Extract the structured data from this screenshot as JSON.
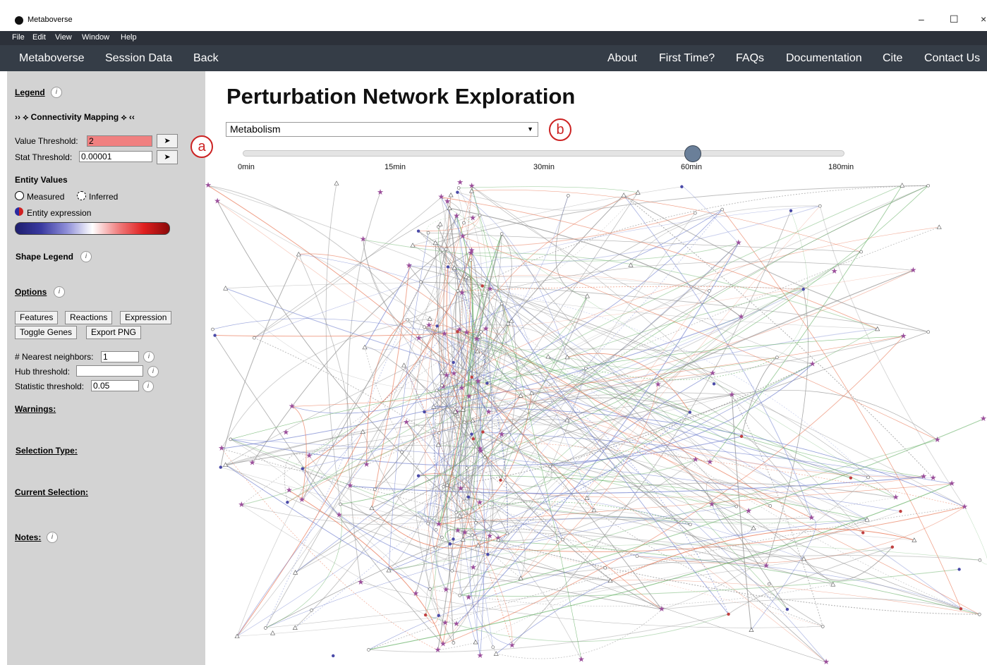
{
  "window": {
    "title": "Metaboverse",
    "minimize": "–",
    "maximize": "☐",
    "close": "×"
  },
  "menubar": [
    "File",
    "Edit",
    "View",
    "Window",
    "Help"
  ],
  "nav": {
    "left": [
      "Metaboverse",
      "Session Data",
      "Back"
    ],
    "right": [
      "About",
      "First Time?",
      "FAQs",
      "Documentation",
      "Cite",
      "Contact Us"
    ]
  },
  "sidebar": {
    "legend": "Legend",
    "connectivity": "›› ⟡ Connectivity Mapping ⟡ ‹‹",
    "value_threshold_label": "Value Threshold:",
    "value_threshold": "2",
    "stat_threshold_label": "Stat Threshold:",
    "stat_threshold": "0.00001",
    "go": "➤",
    "entity_values": "Entity Values",
    "measured": "Measured",
    "inferred": "Inferred",
    "entity_expression": "Entity expression",
    "shape_legend": "Shape Legend",
    "options": "Options",
    "buttons": [
      "Features",
      "Reactions",
      "Expression",
      "Toggle Genes",
      "Export PNG"
    ],
    "nearest_label": "# Nearest neighbors:",
    "nearest_value": "1",
    "hub_label": "Hub threshold:",
    "hub_value": "",
    "stat_label": "Statistic threshold:",
    "stat_value": "0.05",
    "warnings": "Warnings:",
    "selection_type": "Selection Type:",
    "current_selection": "Current Selection:",
    "notes": "Notes:",
    "info": "i"
  },
  "main": {
    "title": "Perturbation Network Exploration",
    "pathway": "Metabolism",
    "slider": {
      "labels": [
        "0min",
        "15min",
        "30min",
        "60min",
        "180min"
      ],
      "selected": "60min",
      "selected_index": 3
    }
  },
  "callouts": [
    "a",
    "b"
  ],
  "colors": {
    "menubar": "#2c313a",
    "navbar": "#353d47",
    "sidebar": "#d3d3d3",
    "value_threshold_bg": "#f08080",
    "callout": "#cc2222",
    "star_node": "#9b4f9b",
    "edge_grey": "#8c8c8c",
    "edge_green": "#5cab5c",
    "edge_red": "#e8704c",
    "edge_blue": "#6a7acc"
  }
}
